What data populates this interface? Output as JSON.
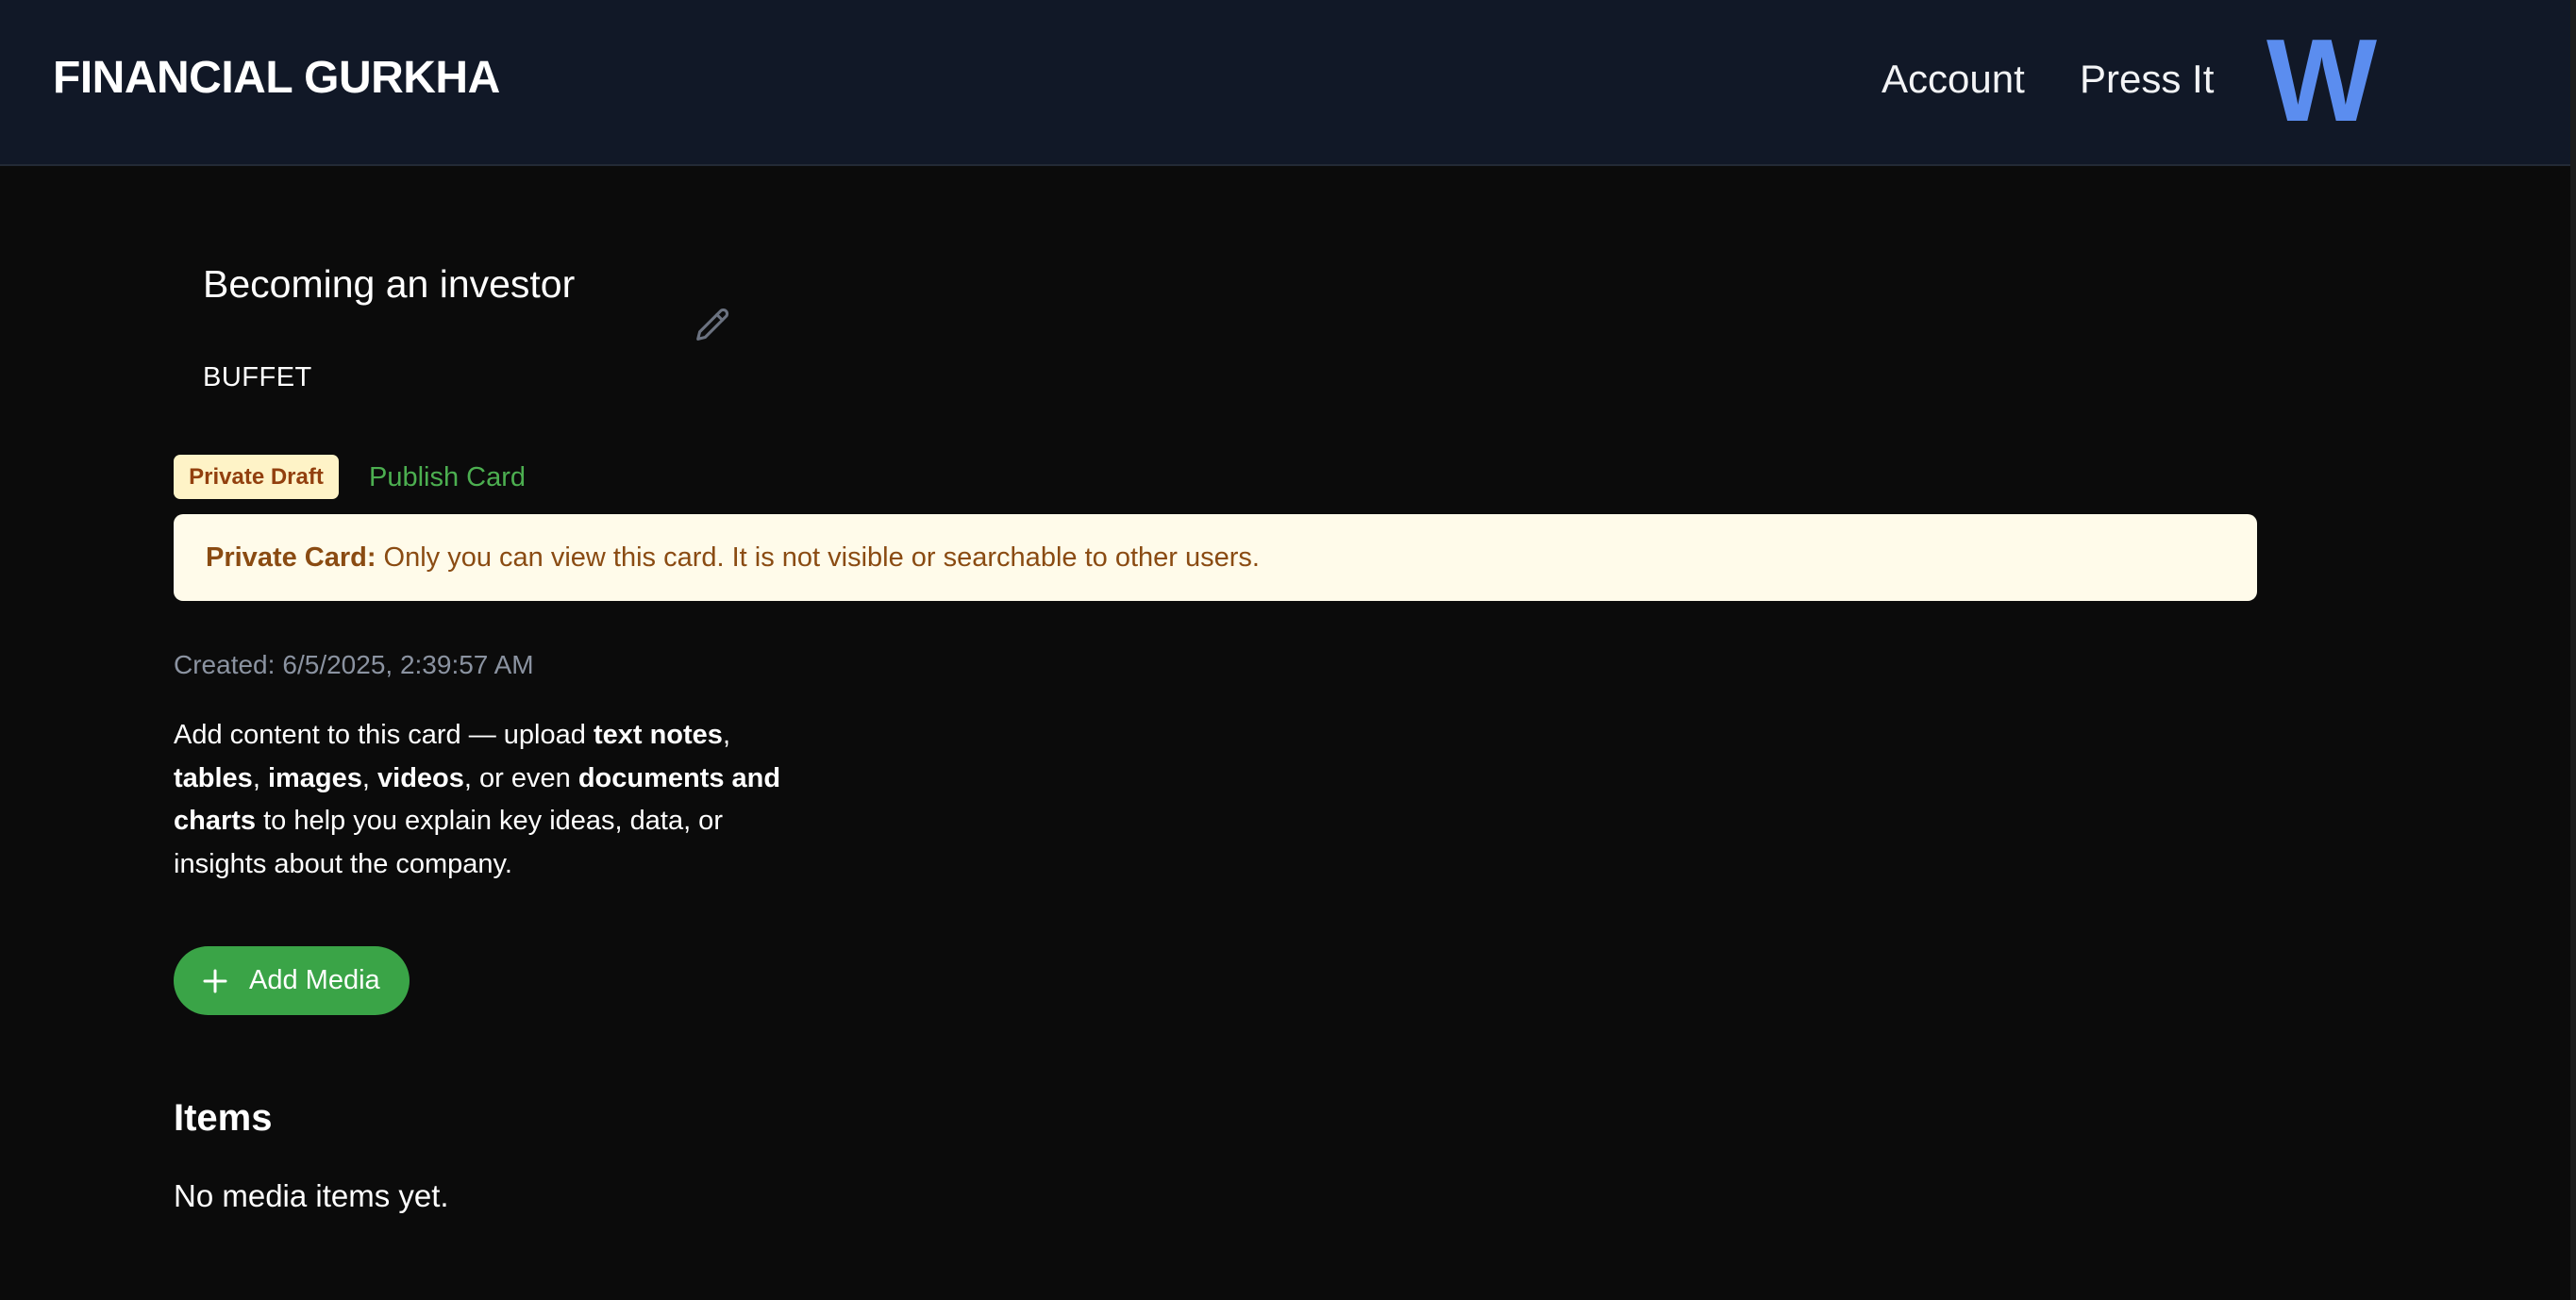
{
  "header": {
    "brand": "FINANCIAL GURKHA",
    "nav": {
      "account": "Account",
      "press_it": "Press It"
    },
    "logo_letter": "W"
  },
  "card": {
    "title": "Becoming an investor",
    "subtitle": "BUFFET",
    "edit_icon": "pencil-icon"
  },
  "status": {
    "badge": "Private Draft",
    "publish_link": "Publish Card"
  },
  "notice": {
    "label": "Private Card:",
    "text": "Only you can view this card. It is not visible or searchable to other users."
  },
  "meta": {
    "created_label": "Created:",
    "created_value": "6/5/2025, 2:39:57 AM"
  },
  "description": {
    "t1": "Add content to this card — upload ",
    "b1": "text notes",
    "t2": ", ",
    "b2": "tables",
    "t3": ", ",
    "b3": "images",
    "t4": ", ",
    "b4": "videos",
    "t5": ", or even ",
    "b5": "documents and charts",
    "t6": " to help you explain key ideas, data, or insights about the company."
  },
  "actions": {
    "add_media": "Add Media",
    "add_media_icon": "plus-icon"
  },
  "items": {
    "heading": "Items",
    "empty": "No media items yet."
  },
  "colors": {
    "header_bg": "#111827",
    "page_bg": "#0b0b0b",
    "accent_green": "#3aa447",
    "publish_green": "#4caf50",
    "logo_blue": "#5b8def",
    "badge_bg": "#fef3c7",
    "badge_text": "#92400e",
    "notice_bg": "#fffbea",
    "notice_text": "#8a4b12",
    "muted_text": "#8b93a1"
  }
}
